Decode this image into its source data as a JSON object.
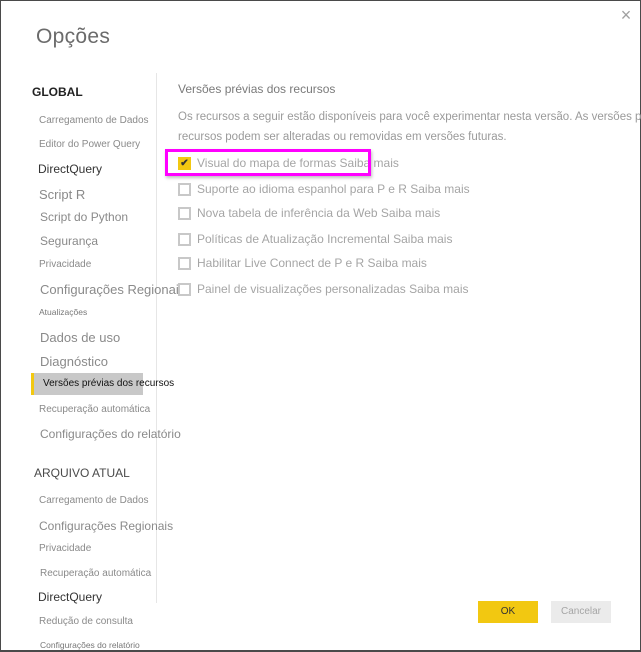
{
  "dialog": {
    "title": "Opções",
    "close_icon": "close-icon"
  },
  "sidebar": {
    "global_header": "GLOBAL",
    "global_items": [
      {
        "label": "Carregamento de Dados"
      },
      {
        "label": "Editor do Power Query"
      },
      {
        "label": "DirectQuery"
      },
      {
        "label": "Script R"
      },
      {
        "label": "Script do Python"
      },
      {
        "label": "Segurança"
      },
      {
        "label": "Privacidade"
      },
      {
        "label": "Configurações Regionais"
      },
      {
        "label": "Atualizações"
      },
      {
        "label": "Dados de uso"
      },
      {
        "label": "Diagnóstico"
      },
      {
        "label": "Versões prévias dos recursos",
        "active": true
      },
      {
        "label": "Recuperação automática"
      },
      {
        "label": "Configurações do relatório"
      }
    ],
    "current_file_header": "ARQUIVO ATUAL",
    "current_file_items": [
      {
        "label": "Carregamento de Dados"
      },
      {
        "label": "Configurações Regionais"
      },
      {
        "label": "Privacidade"
      },
      {
        "label": "Recuperação automática"
      },
      {
        "label": "DirectQuery"
      },
      {
        "label": "Redução de consulta"
      },
      {
        "label": "Configurações do relatório"
      }
    ]
  },
  "content": {
    "heading": "Versões prévias dos recursos",
    "description_line1": "Os recursos a seguir estão disponíveis para você experimentar nesta versão. As versões prévias dos",
    "description_line2": "recursos podem ser alteradas ou removidas em versões futuras.",
    "options": [
      {
        "label": "Visual do mapa de formas Saiba mais",
        "checked": true,
        "check_glyph": "✔"
      },
      {
        "label": "Suporte ao idioma espanhol para P e R Saiba mais",
        "checked": false
      },
      {
        "label": "Nova tabela de inferência da Web Saiba mais",
        "checked": false
      },
      {
        "label": "Políticas de Atualização Incremental Saiba mais",
        "checked": false
      },
      {
        "label": "Habilitar Live Connect de P e R Saiba mais",
        "checked": false
      },
      {
        "label": "Painel de visualizações personalizadas Saiba mais",
        "checked": false
      }
    ]
  },
  "footer": {
    "ok_label": "OK",
    "cancel_label": "Cancelar"
  },
  "colors": {
    "accent": "#f2c811",
    "highlight": "#ff00ff"
  },
  "icons": {
    "close": "×"
  }
}
